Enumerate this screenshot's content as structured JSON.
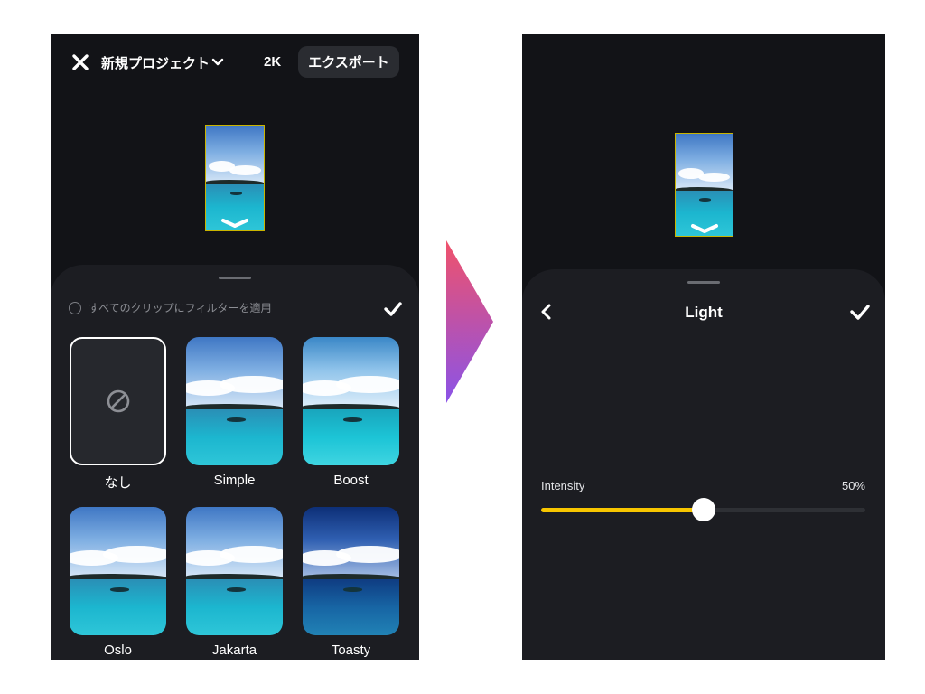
{
  "left_screen": {
    "header": {
      "project_title": "新規プロジェクト",
      "resolution": "2K",
      "export_label": "エクスポート"
    },
    "filter_sheet": {
      "apply_all_label": "すべてのクリップにフィルターを適用",
      "filters": [
        {
          "label": "なし",
          "style": "none",
          "selected": true
        },
        {
          "label": "Simple",
          "style": "normal"
        },
        {
          "label": "Boost",
          "style": "boost"
        },
        {
          "label": "Oslo",
          "style": "normal"
        },
        {
          "label": "Jakarta",
          "style": "normal"
        },
        {
          "label": "Toasty",
          "style": "toasty"
        }
      ]
    }
  },
  "right_screen": {
    "filter_title": "Light",
    "intensity": {
      "label": "Intensity",
      "value_text": "50%",
      "value": 0.5
    }
  },
  "colors": {
    "background": "#121317",
    "sheet": "#1c1d22",
    "slider_accent": "#f7c600",
    "arrow_gradient": [
      "#f0526b",
      "#8a53e8"
    ]
  },
  "icons": {
    "close": "close-icon",
    "chevron": "chevron-down-icon",
    "check": "checkmark-icon",
    "back": "chevron-left-icon",
    "none": "prohibited-icon"
  }
}
